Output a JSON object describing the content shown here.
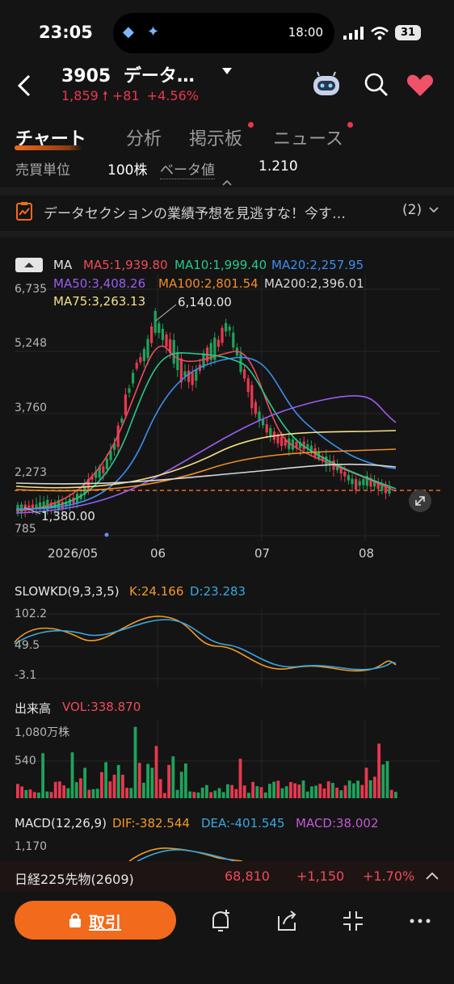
{
  "status_bar": {
    "time": "23:05",
    "island_time": "18:00",
    "battery": "31"
  },
  "header": {
    "code": "3905",
    "name": "データ…",
    "price": "1,859",
    "change": "+81",
    "change_pct": "+4.56%"
  },
  "tabs": [
    {
      "label": "チャート"
    },
    {
      "label": "分析"
    },
    {
      "label": "掲示板"
    },
    {
      "label": "ニュース"
    }
  ],
  "info_row": {
    "lot_label": "売買単位",
    "lot_value": "100株",
    "beta_label": "ベータ値",
    "beta_value": "1.210"
  },
  "banner": {
    "text": "データセクションの業績予想を見逃すな！今す…",
    "count": "(2)"
  },
  "ma_legend": {
    "ma": "MA",
    "ma5": "MA5:1,939.80",
    "ma10": "MA10:1,999.40",
    "ma20": "MA20:2,257.95",
    "ma50": "MA50:3,408.26",
    "ma100": "MA100:2,801.54",
    "ma200": "MA200:2,396.01",
    "ma75": "MA75:3,263.13"
  },
  "price_axis": [
    "6,735",
    "5,248",
    "3,760",
    "2,273",
    "785"
  ],
  "annotations": {
    "high": "6,140.00",
    "low": "1,380.00"
  },
  "date_axis": [
    "2026/05",
    "06",
    "07",
    "08"
  ],
  "slowkd": {
    "title": "SLOWKD(9,3,3,5)",
    "k": "K:24.166",
    "d": "D:23.283",
    "axis": [
      "102.2",
      "49.5",
      "-3.1"
    ]
  },
  "volume": {
    "title": "出来高",
    "vol": "VOL:338.870",
    "axis": [
      "1,080万株",
      "540"
    ]
  },
  "macd": {
    "title": "MACD(12,26,9)",
    "dif": "DIF:-382.544",
    "dea": "DEA:-401.545",
    "macd": "MACD:38.002",
    "axis": [
      "1,170"
    ]
  },
  "index_bar": {
    "name": "日経225先物(2609)",
    "value": "68,810",
    "change": "+1,150",
    "pct": "+1.70%"
  },
  "toolbar": {
    "trade_label": "取引"
  },
  "colors": {
    "up": "#e8384f",
    "down": "#1ea35a",
    "accent": "#f26a1b",
    "ma5": "#ef4b5c",
    "ma10": "#27c98b",
    "ma20": "#3b8ef0",
    "ma50": "#9b5cf0",
    "ma100": "#f28c28",
    "ma200": "#d8d8d8",
    "ma75": "#f5e08a",
    "k": "#f59a23",
    "d": "#38a7e0",
    "macd": "#c25ad6"
  },
  "icons": [
    "back-arrow-icon",
    "dropdown-icon",
    "robot-icon",
    "search-icon",
    "heart-icon",
    "clipboard-chart-icon",
    "chevron-down-icon",
    "expand-icon",
    "chevron-up-icon",
    "lock-icon",
    "alert-bell-icon",
    "share-icon",
    "fullscreen-icon",
    "more-icon"
  ]
}
